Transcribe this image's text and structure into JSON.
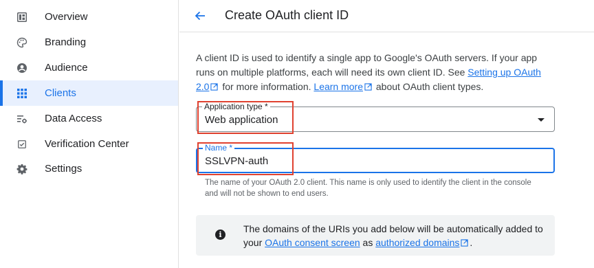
{
  "sidebar": {
    "items": [
      {
        "label": "Overview",
        "icon": "dashboard-icon"
      },
      {
        "label": "Branding",
        "icon": "palette-icon"
      },
      {
        "label": "Audience",
        "icon": "account-circle-icon"
      },
      {
        "label": "Clients",
        "icon": "apps-grid-icon",
        "active": true
      },
      {
        "label": "Data Access",
        "icon": "data-settings-icon"
      },
      {
        "label": "Verification Center",
        "icon": "checkbox-icon"
      },
      {
        "label": "Settings",
        "icon": "gear-icon"
      }
    ]
  },
  "header": {
    "back_icon": "arrow-back-icon",
    "title": "Create OAuth client ID"
  },
  "intro": {
    "text1": "A client ID is used to identify a single app to Google's OAuth servers. If your app runs on multiple platforms, each will need its own client ID. See ",
    "link1": "Setting up OAuth 2.0",
    "text2": " for more information. ",
    "link2": "Learn more",
    "text3": " about OAuth client types."
  },
  "form": {
    "application_type": {
      "label": "Application type *",
      "value": "Web application"
    },
    "name": {
      "label": "Name *",
      "value": "SSLVPN-auth"
    },
    "name_helper": "The name of your OAuth 2.0 client. This name is only used to identify the client in the console and will not be shown to end users."
  },
  "banner": {
    "text1": "The domains of the URIs you add below will be automatically added to your ",
    "link1": "OAuth consent screen",
    "text2": " as ",
    "link2": "authorized domains",
    "text3": "."
  },
  "colors": {
    "accent": "#1a73e8",
    "highlight": "#e0412f",
    "active_bg": "#e8f0fe"
  }
}
